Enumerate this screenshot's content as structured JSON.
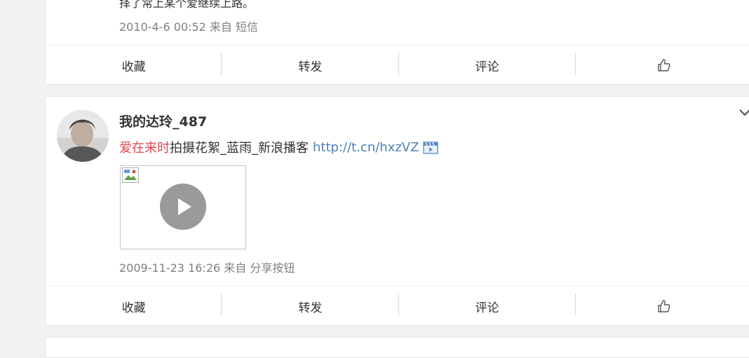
{
  "feed": {
    "post1": {
      "partial_text": "择了常上某个爱继续上路。",
      "meta": "2010-4-6 00:52 来自 短信",
      "actions": {
        "favorite": "收藏",
        "repost": "转发",
        "comment": "评论",
        "like_icon": "thumbs-up-icon"
      }
    },
    "post2": {
      "username": "我的达玲_487",
      "topic": "爱在来时",
      "text": "拍摄花絮_蓝雨_新浪播客",
      "link": "http://t.cn/hxzVZ",
      "link_icon": "video-icon",
      "media": {
        "type": "video",
        "play_icon": "play-icon",
        "broken_image_icon": "broken-image-icon"
      },
      "meta": "2009-11-23 16:26 来自 分享按钮",
      "menu_icon": "chevron-down-icon",
      "actions": {
        "favorite": "收藏",
        "repost": "转发",
        "comment": "评论",
        "like_icon": "thumbs-up-icon"
      }
    }
  },
  "colors": {
    "topic": "#e0454f",
    "link": "#4f80b3",
    "meta": "#808080",
    "background": "#f2f2f5"
  }
}
